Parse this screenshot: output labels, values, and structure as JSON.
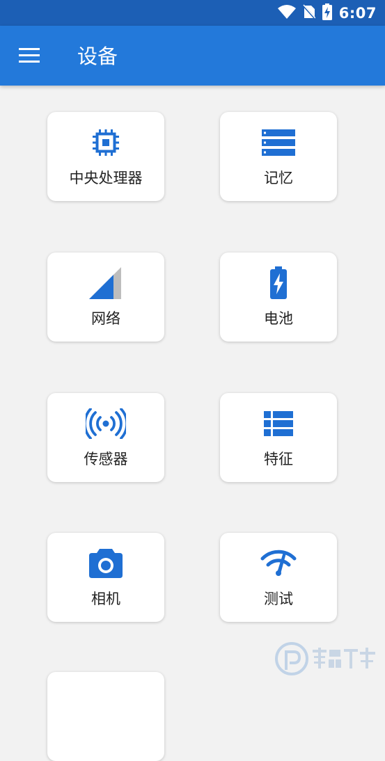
{
  "status_bar": {
    "time": "6:07"
  },
  "app_bar": {
    "title": "设备"
  },
  "colors": {
    "accent": "#1f6fd3",
    "app_bar": "#2379da",
    "status_bar": "#1c5fb5",
    "background": "#f2f2f2"
  },
  "cards": [
    {
      "label": "中央处理器",
      "icon": "cpu-icon"
    },
    {
      "label": "记忆",
      "icon": "memory-icon"
    },
    {
      "label": "网络",
      "icon": "signal-icon"
    },
    {
      "label": "电池",
      "icon": "battery-charging-icon"
    },
    {
      "label": "传感器",
      "icon": "sensor-icon"
    },
    {
      "label": "特征",
      "icon": "features-list-icon"
    },
    {
      "label": "相机",
      "icon": "camera-icon"
    },
    {
      "label": "测试",
      "icon": "wifi-test-icon"
    }
  ]
}
